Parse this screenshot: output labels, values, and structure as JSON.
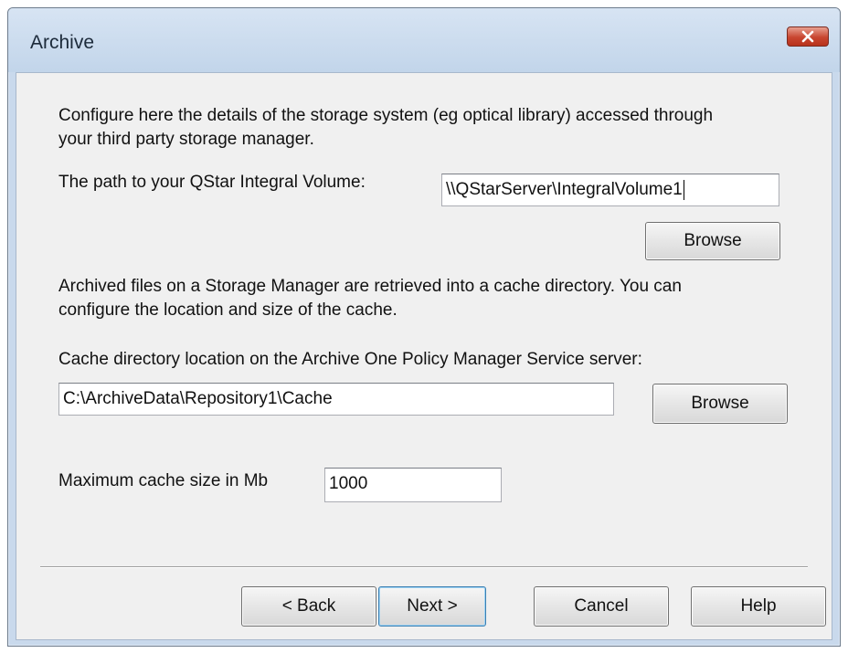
{
  "window": {
    "title": "Archive",
    "close_icon": "close-icon"
  },
  "intro": {
    "line1": "Configure here the details of the storage system (eg optical library) accessed through",
    "line2": "your third party storage manager."
  },
  "qstar": {
    "label": "The path to your QStar Integral Volume:",
    "value": "\\\\QStarServer\\IntegralVolume1",
    "browse_label": "Browse"
  },
  "cache_intro": {
    "line1": "Archived files on a Storage Manager are retrieved into a cache directory. You can",
    "line2": "configure the location and size of the cache."
  },
  "cache_dir": {
    "label": "Cache directory location on the Archive One Policy Manager Service server:",
    "value": "C:\\ArchiveData\\Repository1\\Cache",
    "browse_label": "Browse"
  },
  "cache_size": {
    "label": "Maximum cache size in Mb",
    "value": "1000"
  },
  "footer": {
    "back_label": "< Back",
    "next_label": "Next >",
    "cancel_label": "Cancel",
    "help_label": "Help"
  }
}
